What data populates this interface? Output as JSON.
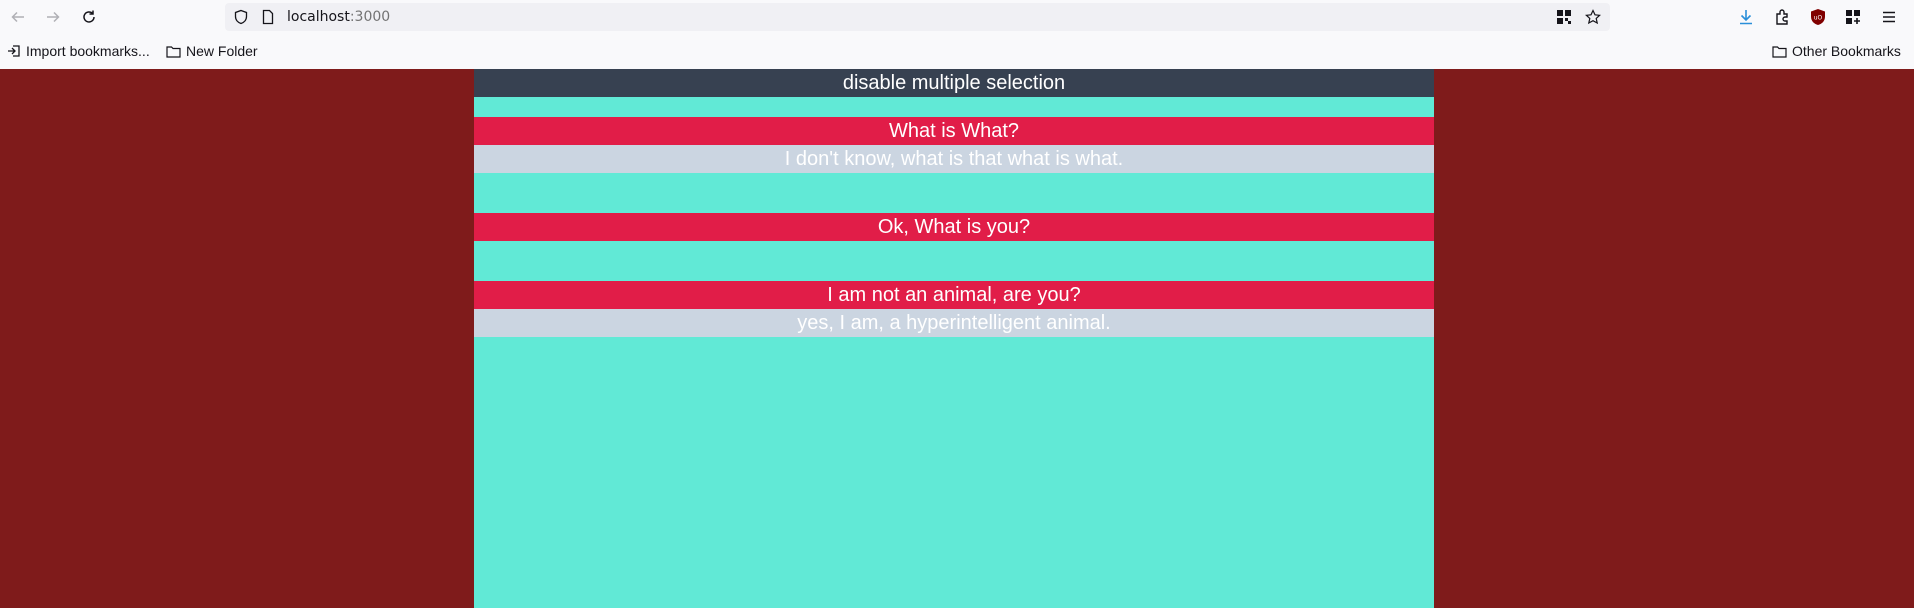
{
  "browser": {
    "url_host": "localhost",
    "url_port": ":3000",
    "icons": {
      "back": "back-arrow-icon",
      "forward": "forward-arrow-icon",
      "reload": "reload-icon",
      "shield": "shield-icon",
      "page": "page-icon",
      "qr": "qr-code-icon",
      "star": "bookmark-star-icon",
      "download": "download-icon",
      "extensions": "extensions-icon",
      "ublock": "ublock-origin-icon",
      "grid": "apps-grid-icon",
      "menu": "hamburger-menu-icon"
    }
  },
  "bookmarks": {
    "import_label": "Import bookmarks...",
    "folder_label": "New Folder",
    "other_label": "Other Bookmarks"
  },
  "colors": {
    "page_background": "#7f1b1b",
    "column_background": "#61e9d6",
    "header_background": "#374151",
    "question_background": "#e11d48",
    "answer_background": "#cbd5e1"
  },
  "header": {
    "label": "disable multiple selection"
  },
  "accordion": {
    "items": [
      {
        "question": "What is What?",
        "answer": "I don't know, what is that what is what.",
        "expanded": true
      },
      {
        "question": "Ok, What is you?",
        "answer": "",
        "expanded": false
      },
      {
        "question": "I am not an animal, are you?",
        "answer": "yes, I am, a hyperintelligent animal.",
        "expanded": true
      }
    ]
  }
}
